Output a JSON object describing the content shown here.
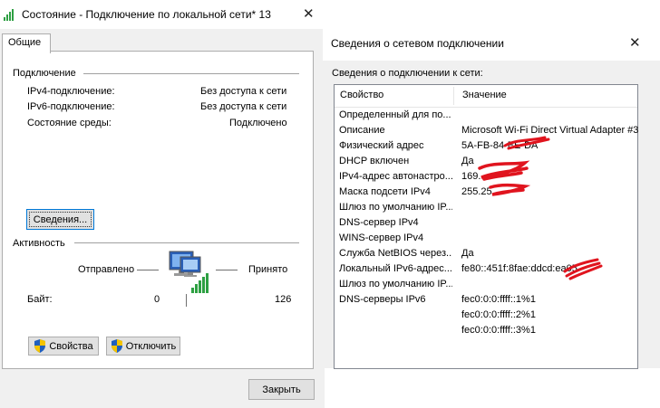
{
  "status_window": {
    "title": "Состояние - Подключение по локальной сети* 13",
    "tab_general": "Общие",
    "connection_group": "Подключение",
    "rows": [
      {
        "label": "IPv4-подключение:",
        "value": "Без доступа к сети"
      },
      {
        "label": "IPv6-подключение:",
        "value": "Без доступа к сети"
      },
      {
        "label": "Состояние среды:",
        "value": "Подключено"
      }
    ],
    "details_button": "Сведения...",
    "activity_group": "Активность",
    "sent_label": "Отправлено",
    "received_label": "Принято",
    "bytes_label": "Байт:",
    "bytes_sent": "0",
    "bytes_received": "126",
    "properties_button": "Свойства",
    "disable_button": "Отключить",
    "close_button": "Закрыть"
  },
  "details_window": {
    "title": "Сведения о сетевом подключении",
    "subtitle": "Сведения о подключении к сети:",
    "col_property": "Свойство",
    "col_value": "Значение",
    "rows": [
      {
        "property": "Определенный для по...",
        "value": ""
      },
      {
        "property": "Описание",
        "value": "Microsoft Wi-Fi Direct Virtual Adapter #3"
      },
      {
        "property": "Физический адрес",
        "value": "5A-FB-84-EE-DA"
      },
      {
        "property": "DHCP включен",
        "value": "Да"
      },
      {
        "property": "IPv4-адрес автонастро...",
        "value": "169."
      },
      {
        "property": "Маска подсети IPv4",
        "value": "255.25"
      },
      {
        "property": "Шлюз по умолчанию IP...",
        "value": ""
      },
      {
        "property": "DNS-сервер IPv4",
        "value": ""
      },
      {
        "property": "WINS-сервер IPv4",
        "value": ""
      },
      {
        "property": "Служба NetBIOS через...",
        "value": "Да"
      },
      {
        "property": "Локальный IPv6-адрес...",
        "value": "fe80::451f:8fae:ddcd:ea05"
      },
      {
        "property": "Шлюз по умолчанию IP...",
        "value": ""
      },
      {
        "property": "DNS-серверы IPv6",
        "value": "fec0:0:0:ffff::1%1"
      },
      {
        "property": "",
        "value": "fec0:0:0:ffff::2%1"
      },
      {
        "property": "",
        "value": "fec0:0:0:ffff::3%1"
      }
    ]
  },
  "colors": {
    "accent_blue": "#0078d7",
    "signal_green": "#2ea043",
    "redaction_red": "#e0141e"
  }
}
